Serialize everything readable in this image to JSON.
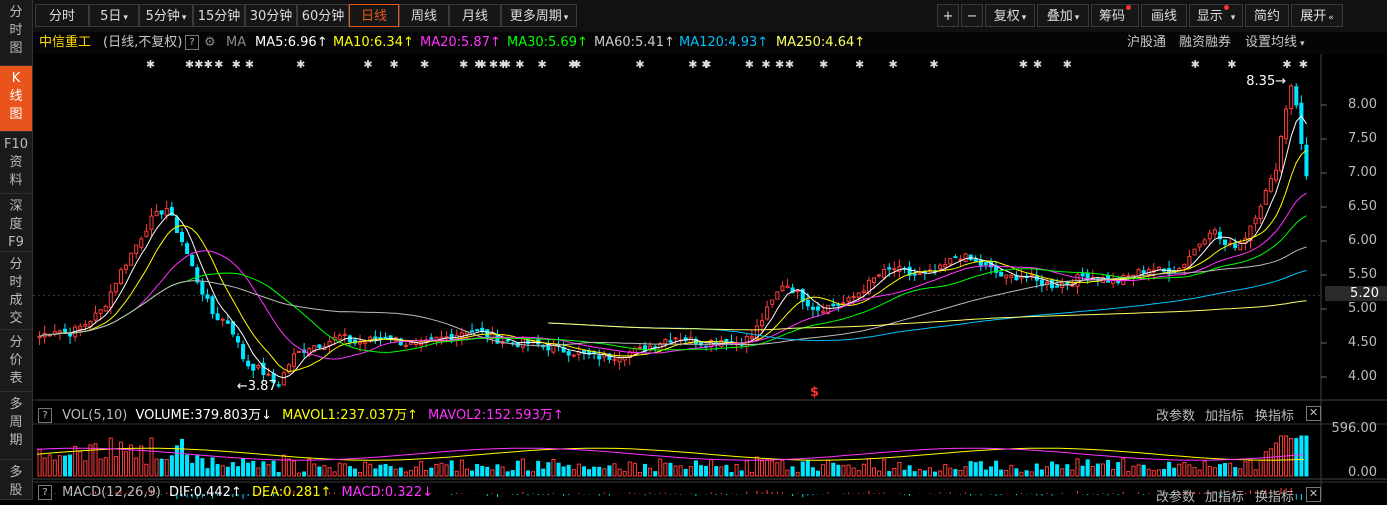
{
  "sidebar": {
    "items": [
      {
        "label": "分时图",
        "lines": [
          "分",
          "时",
          "图"
        ]
      },
      {
        "label": "K线图",
        "lines": [
          "K",
          "线",
          "图"
        ],
        "active": true
      },
      {
        "label": "F10资料",
        "lines": [
          "F10",
          "资",
          "料"
        ]
      },
      {
        "label": "深度F9",
        "lines": [
          "深",
          "度",
          "F9"
        ]
      },
      {
        "label": "分时成交",
        "lines": [
          "分",
          "时",
          "成",
          "交"
        ]
      },
      {
        "label": "分价表",
        "lines": [
          "分",
          "价",
          "表"
        ]
      },
      {
        "label": "多周期",
        "lines": [
          "多",
          "周",
          "期"
        ]
      },
      {
        "label": "多股",
        "lines": [
          "多",
          "股"
        ]
      }
    ]
  },
  "toolbar": {
    "periods": [
      "分时",
      "5日",
      "5分钟",
      "15分钟",
      "30分钟",
      "60分钟",
      "日线",
      "周线",
      "月线",
      "更多周期"
    ],
    "active_period": "日线",
    "right_buttons": [
      "+",
      "−",
      "复权",
      "叠加",
      "筹码",
      "画线",
      "显示",
      "简约",
      "展开"
    ]
  },
  "info": {
    "stock_name": "中信重工",
    "mode": "(日线,不复权)",
    "ma_label": "MA",
    "ma5": "MA5:6.96",
    "ma10": "MA10:6.34",
    "ma20": "MA20:5.87",
    "ma30": "MA30:5.69",
    "ma60": "MA60:5.41",
    "ma120": "MA120:4.93",
    "ma250": "MA250:4.64",
    "links": [
      "沪股通",
      "融资融券",
      "设置均线"
    ],
    "arrow_up": "↑",
    "arrow_down": "↓"
  },
  "colors": {
    "up": "#ff3b3b",
    "down": "#00e5ff",
    "ma5": "#ffffff",
    "ma10": "#ffff00",
    "ma20": "#ff33ff",
    "ma30": "#00ff00",
    "ma60": "#bbbbbb",
    "ma120": "#00bfff",
    "ma250": "#ffff66"
  },
  "price_axis": {
    "ticks": [
      "8.00",
      "7.50",
      "7.00",
      "6.50",
      "6.00",
      "5.50",
      "5.00",
      "4.50",
      "4.00"
    ],
    "current": "5.20",
    "high_label": "8.35",
    "low_label": "3.87"
  },
  "volume_panel": {
    "title": "VOL(5,10)",
    "volume": "VOLUME:379.803万",
    "mavol1": "MAVOL1:237.037万",
    "mavol2": "MAVOL2:152.593万",
    "axis_top": "596.00",
    "axis_bottom": "0.00",
    "tools": [
      "改参数",
      "加指标",
      "换指标"
    ]
  },
  "macd_panel": {
    "title": "MACD(12,26,9)",
    "dif": "DIF:0.442",
    "dea": "DEA:0.281",
    "macd": "MACD:0.322",
    "tools": [
      "改参数",
      "加指标",
      "换指标"
    ]
  },
  "chart_data": {
    "type": "candlestick",
    "title": "中信重工",
    "series": [
      {
        "name": "K线",
        "values": [
          4.6,
          4.7,
          4.65,
          4.8,
          5.0,
          5.5,
          5.9,
          6.3,
          6.5,
          6.0,
          5.4,
          4.9,
          4.8,
          4.2,
          4.1,
          3.87,
          4.3,
          4.45,
          4.5,
          4.6,
          4.5,
          4.55,
          4.6,
          4.5,
          4.45,
          4.55,
          4.6,
          4.7,
          4.65,
          4.55,
          4.5,
          4.5,
          4.45,
          4.4,
          4.35,
          4.3,
          4.3,
          4.35,
          4.4,
          4.5,
          4.6,
          4.55,
          4.5,
          4.55,
          4.5,
          4.6,
          5.0,
          5.4,
          5.2,
          5.0,
          5.05,
          5.1,
          5.3,
          5.5,
          5.6,
          5.5,
          5.5,
          5.6,
          5.8,
          5.7,
          5.6,
          5.45,
          5.5,
          5.4,
          5.35,
          5.4,
          5.5,
          5.45,
          5.4,
          5.5,
          5.6,
          5.55,
          5.6,
          5.9,
          6.2,
          5.9,
          6.0,
          6.5,
          7.0,
          8.35,
          6.96
        ]
      }
    ]
  }
}
